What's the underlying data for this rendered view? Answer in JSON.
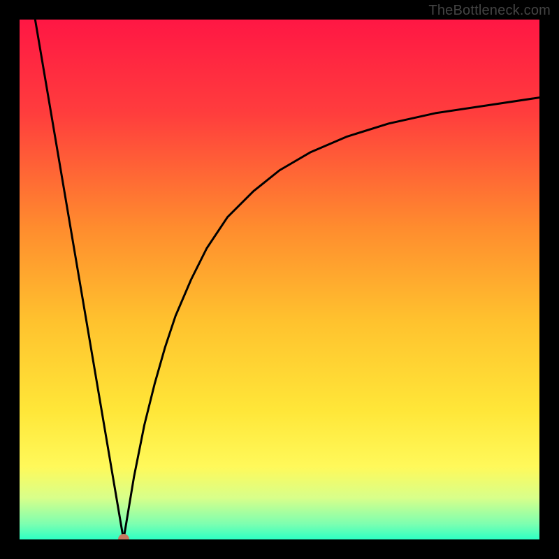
{
  "watermark": "TheBottleneck.com",
  "colors": {
    "frame": "#000000",
    "curve": "#000000",
    "marker": "#c77860",
    "gradient_stops": [
      {
        "offset": 0.0,
        "color": "#ff1744"
      },
      {
        "offset": 0.18,
        "color": "#ff3d3d"
      },
      {
        "offset": 0.4,
        "color": "#ff8c2e"
      },
      {
        "offset": 0.58,
        "color": "#ffc22e"
      },
      {
        "offset": 0.75,
        "color": "#ffe638"
      },
      {
        "offset": 0.86,
        "color": "#fff95a"
      },
      {
        "offset": 0.92,
        "color": "#d8ff8a"
      },
      {
        "offset": 0.97,
        "color": "#7dffb0"
      },
      {
        "offset": 1.0,
        "color": "#2dffc4"
      }
    ]
  },
  "chart_data": {
    "type": "line",
    "title": "",
    "xlabel": "",
    "ylabel": "",
    "xlim": [
      0,
      100
    ],
    "ylim": [
      0,
      100
    ],
    "legend": false,
    "grid": false,
    "marker": {
      "x": 20,
      "y": 0
    },
    "series": [
      {
        "name": "left-line",
        "x": [
          3,
          20
        ],
        "values": [
          100,
          0
        ]
      },
      {
        "name": "right-curve",
        "x": [
          20,
          22,
          24,
          26,
          28,
          30,
          33,
          36,
          40,
          45,
          50,
          56,
          63,
          71,
          80,
          90,
          100
        ],
        "values": [
          0,
          12,
          22,
          30,
          37,
          43,
          50,
          56,
          62,
          67,
          71,
          74.5,
          77.5,
          80,
          82,
          83.5,
          85
        ]
      }
    ]
  }
}
